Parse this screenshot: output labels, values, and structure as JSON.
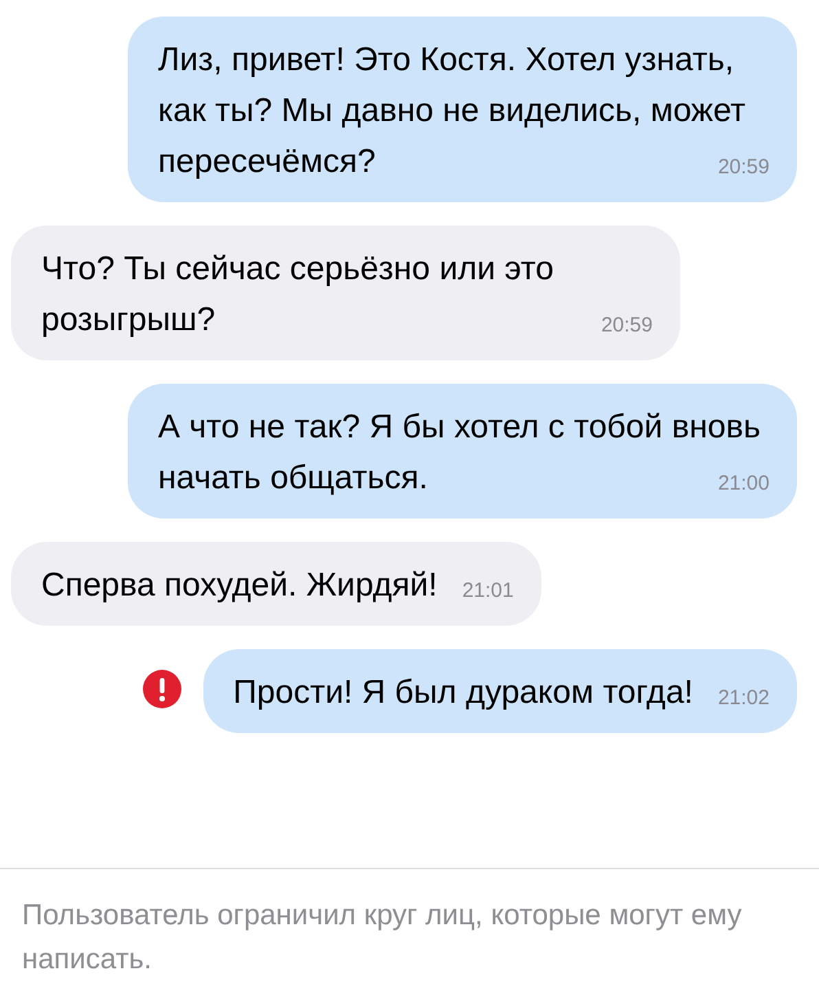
{
  "messages": [
    {
      "kind": "outgoing",
      "text": "Лиз, привет! Это Костя. Хотел узнать, как ты? Мы давно не виделись, может пересечёмся?",
      "time": "20:59",
      "failed": false
    },
    {
      "kind": "incoming",
      "text": "Что? Ты сейчас серьёзно или это розыгрыш?",
      "time": "20:59",
      "failed": false
    },
    {
      "kind": "outgoing",
      "text": "А что не так? Я бы хотел с тобой вновь начать общаться.",
      "time": "21:00",
      "failed": false
    },
    {
      "kind": "incoming",
      "text": "Сперва похудей. Жирдяй!",
      "time": "21:01",
      "failed": false
    },
    {
      "kind": "outgoing",
      "text": "Прости! Я был дураком тогда!",
      "time": "21:02",
      "failed": true
    }
  ],
  "notice": "Пользователь ограничил круг лиц, которые могут ему написать."
}
